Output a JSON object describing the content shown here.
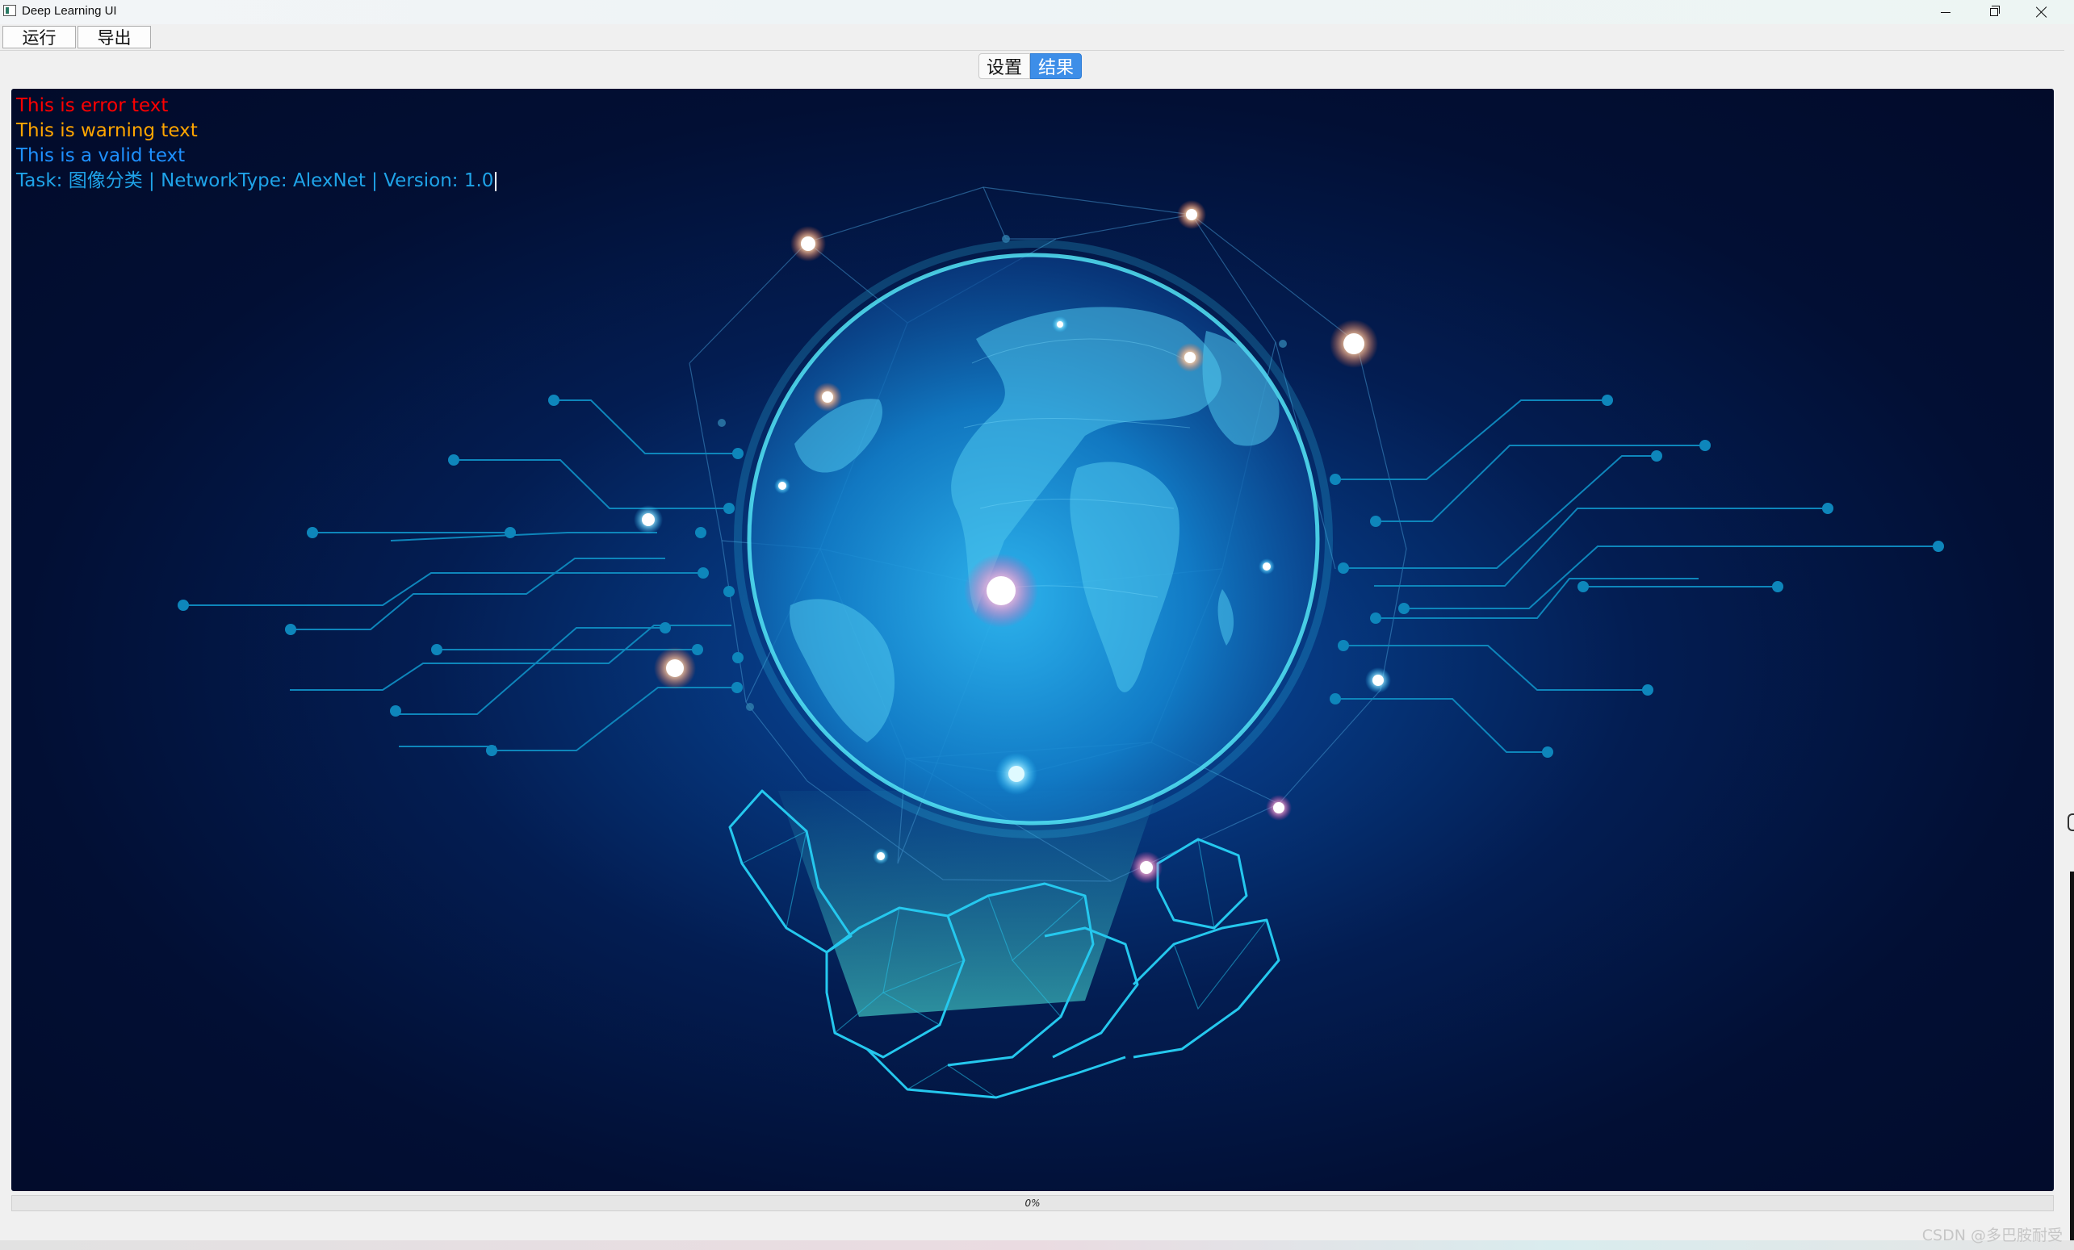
{
  "window": {
    "title": "Deep Learning UI",
    "controls": [
      "minimize-icon",
      "restore-icon",
      "close-icon"
    ]
  },
  "toolbar": {
    "run_label": "运行",
    "export_label": "导出"
  },
  "tabs": [
    {
      "label": "设置",
      "active": false
    },
    {
      "label": "结果",
      "active": true
    }
  ],
  "log": {
    "lines": [
      {
        "text": "This is error text",
        "level": "error",
        "color": "#ff0000"
      },
      {
        "text": "This is warning text",
        "level": "warning",
        "color": "#ffa500"
      },
      {
        "text": "This is a valid text",
        "level": "valid",
        "color": "#1e90ff"
      },
      {
        "text": "Task: 图像分类 | NetworkType: AlexNet | Version: 1.0",
        "level": "info",
        "color": "#1fa3e8"
      }
    ]
  },
  "background_image": "globe-in-hand-network-illustration",
  "colors": {
    "tab_active": "#3d8ee8",
    "panel_bg": "#020f34",
    "circuit": "#0f8fc0",
    "globe": "#1ec8e8"
  },
  "progress": {
    "value_percent": 0,
    "text": "0%"
  },
  "watermark": "CSDN @多巴胺耐受"
}
